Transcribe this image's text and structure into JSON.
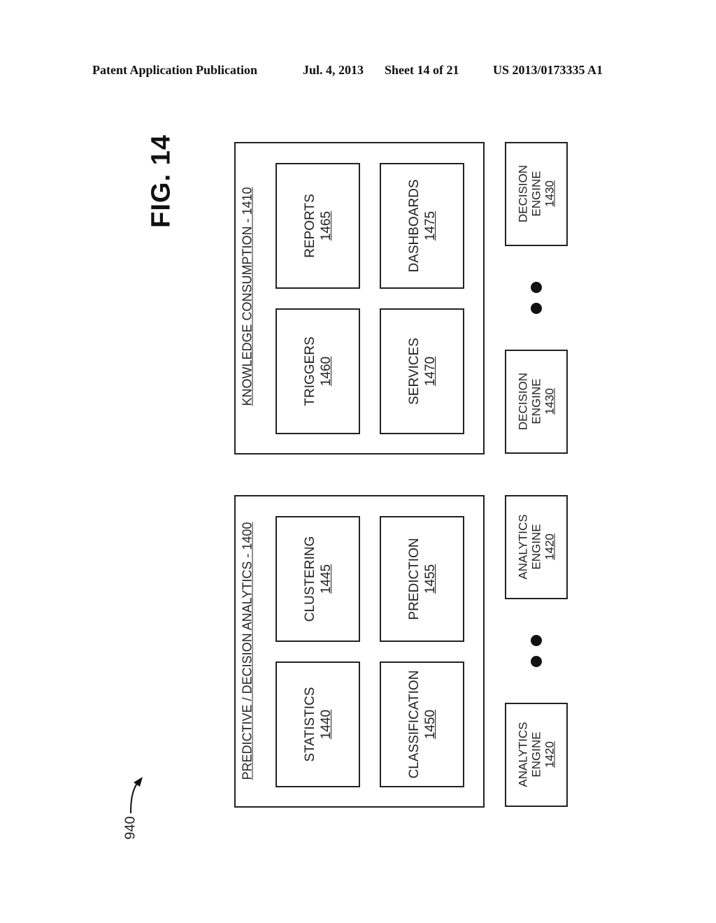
{
  "header": {
    "publication": "Patent Application Publication",
    "date": "Jul. 4, 2013",
    "sheet": "Sheet 14 of 21",
    "number": "US 2013/0173335 A1"
  },
  "figure": {
    "label": "FIG. 14",
    "reference": "940"
  },
  "knowledge_consumption": {
    "title": "KNOWLEDGE CONSUMPTION - 1410",
    "items": [
      {
        "label": "REPORTS",
        "number": "1465"
      },
      {
        "label": "TRIGGERS",
        "number": "1460"
      },
      {
        "label": "DASHBOARDS",
        "number": "1475"
      },
      {
        "label": "SERVICES",
        "number": "1470"
      }
    ]
  },
  "predictive_analytics": {
    "title": "PREDICTIVE / DECISION ANALYTICS - 1400",
    "items": [
      {
        "label": "CLUSTERING",
        "number": "1445"
      },
      {
        "label": "STATISTICS",
        "number": "1440"
      },
      {
        "label": "PREDICTION",
        "number": "1455"
      },
      {
        "label": "CLASSIFICATION",
        "number": "1450"
      }
    ]
  },
  "decision_engines": [
    {
      "line1": "DECISION",
      "line2": "ENGINE",
      "number": "1430"
    },
    {
      "line1": "DECISION",
      "line2": "ENGINE",
      "number": "1430"
    }
  ],
  "analytics_engines": [
    {
      "line1": "ANALYTICS",
      "line2": "ENGINE",
      "number": "1420"
    },
    {
      "line1": "ANALYTICS",
      "line2": "ENGINE",
      "number": "1420"
    }
  ]
}
